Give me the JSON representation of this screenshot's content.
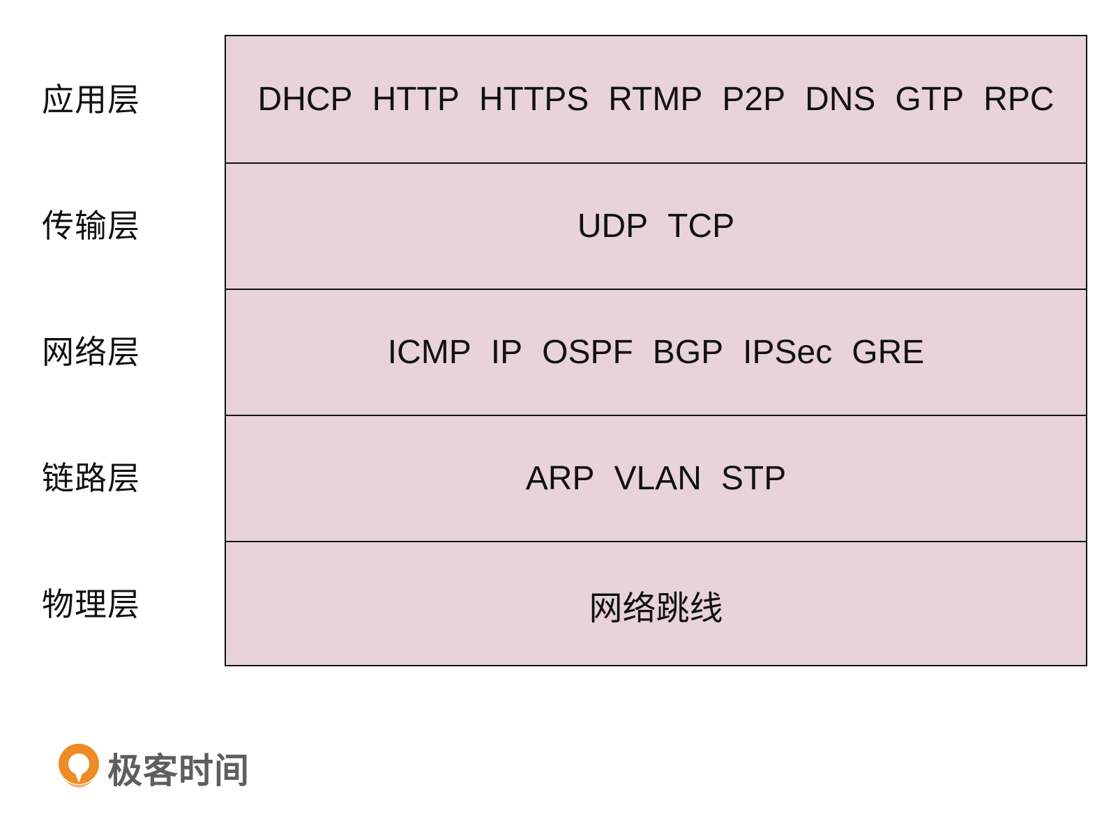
{
  "layers": [
    {
      "label": "应用层",
      "protocols": [
        "DHCP",
        "HTTP",
        "HTTPS",
        "RTMP",
        "P2P",
        "DNS",
        "GTP",
        "RPC"
      ]
    },
    {
      "label": "传输层",
      "protocols": [
        "UDP",
        "TCP"
      ]
    },
    {
      "label": "网络层",
      "protocols": [
        "ICMP",
        "IP",
        "OSPF",
        "BGP",
        "IPSec",
        "GRE"
      ]
    },
    {
      "label": "链路层",
      "protocols": [
        "ARP",
        "VLAN",
        "STP"
      ]
    },
    {
      "label": "物理层",
      "protocols": [
        "网络跳线"
      ]
    }
  ],
  "logo": {
    "text": "极客时间",
    "icon": "geektime-logo-icon"
  },
  "colors": {
    "layer_fill": "#e8d3d8",
    "border": "#111111",
    "logo_orange": "#f08a24",
    "logo_text": "#5e5e5e"
  }
}
